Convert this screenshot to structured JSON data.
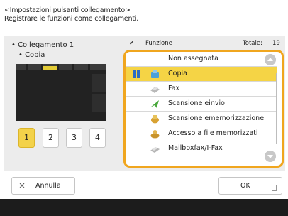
{
  "header": {
    "line1": "<Impostazioni pulsanti collegamento>",
    "line2": "Registrare le funzioni come collegamenti."
  },
  "left": {
    "title": "• Collegamento 1",
    "subtitle": "• Copia",
    "pages": [
      "1",
      "2",
      "3",
      "4"
    ],
    "active_page": "1"
  },
  "list": {
    "check_mark": "✔",
    "column_label": "Funzione",
    "total_label": "Totale:",
    "total_value": "19",
    "items": [
      {
        "label": "Non assegnata",
        "icon": "none"
      },
      {
        "label": "Copia",
        "icon": "copy-icon",
        "selected": true
      },
      {
        "label": "Fax",
        "icon": "fax-icon"
      },
      {
        "label": "Scansione einvio",
        "icon": "scan-send-icon"
      },
      {
        "label": "Scansione ememorizzazione",
        "icon": "scan-store-icon"
      },
      {
        "label": "Accesso a file memorizzati",
        "icon": "stored-files-icon"
      },
      {
        "label": "Mailboxfax/I-Fax",
        "icon": "mailbox-icon"
      }
    ]
  },
  "buttons": {
    "cancel_icon": "×",
    "cancel_label": "Annulla",
    "ok_label": "OK"
  },
  "colors": {
    "accent": "#f0a61f",
    "selected": "#f5d445",
    "panel": "#ececec"
  }
}
